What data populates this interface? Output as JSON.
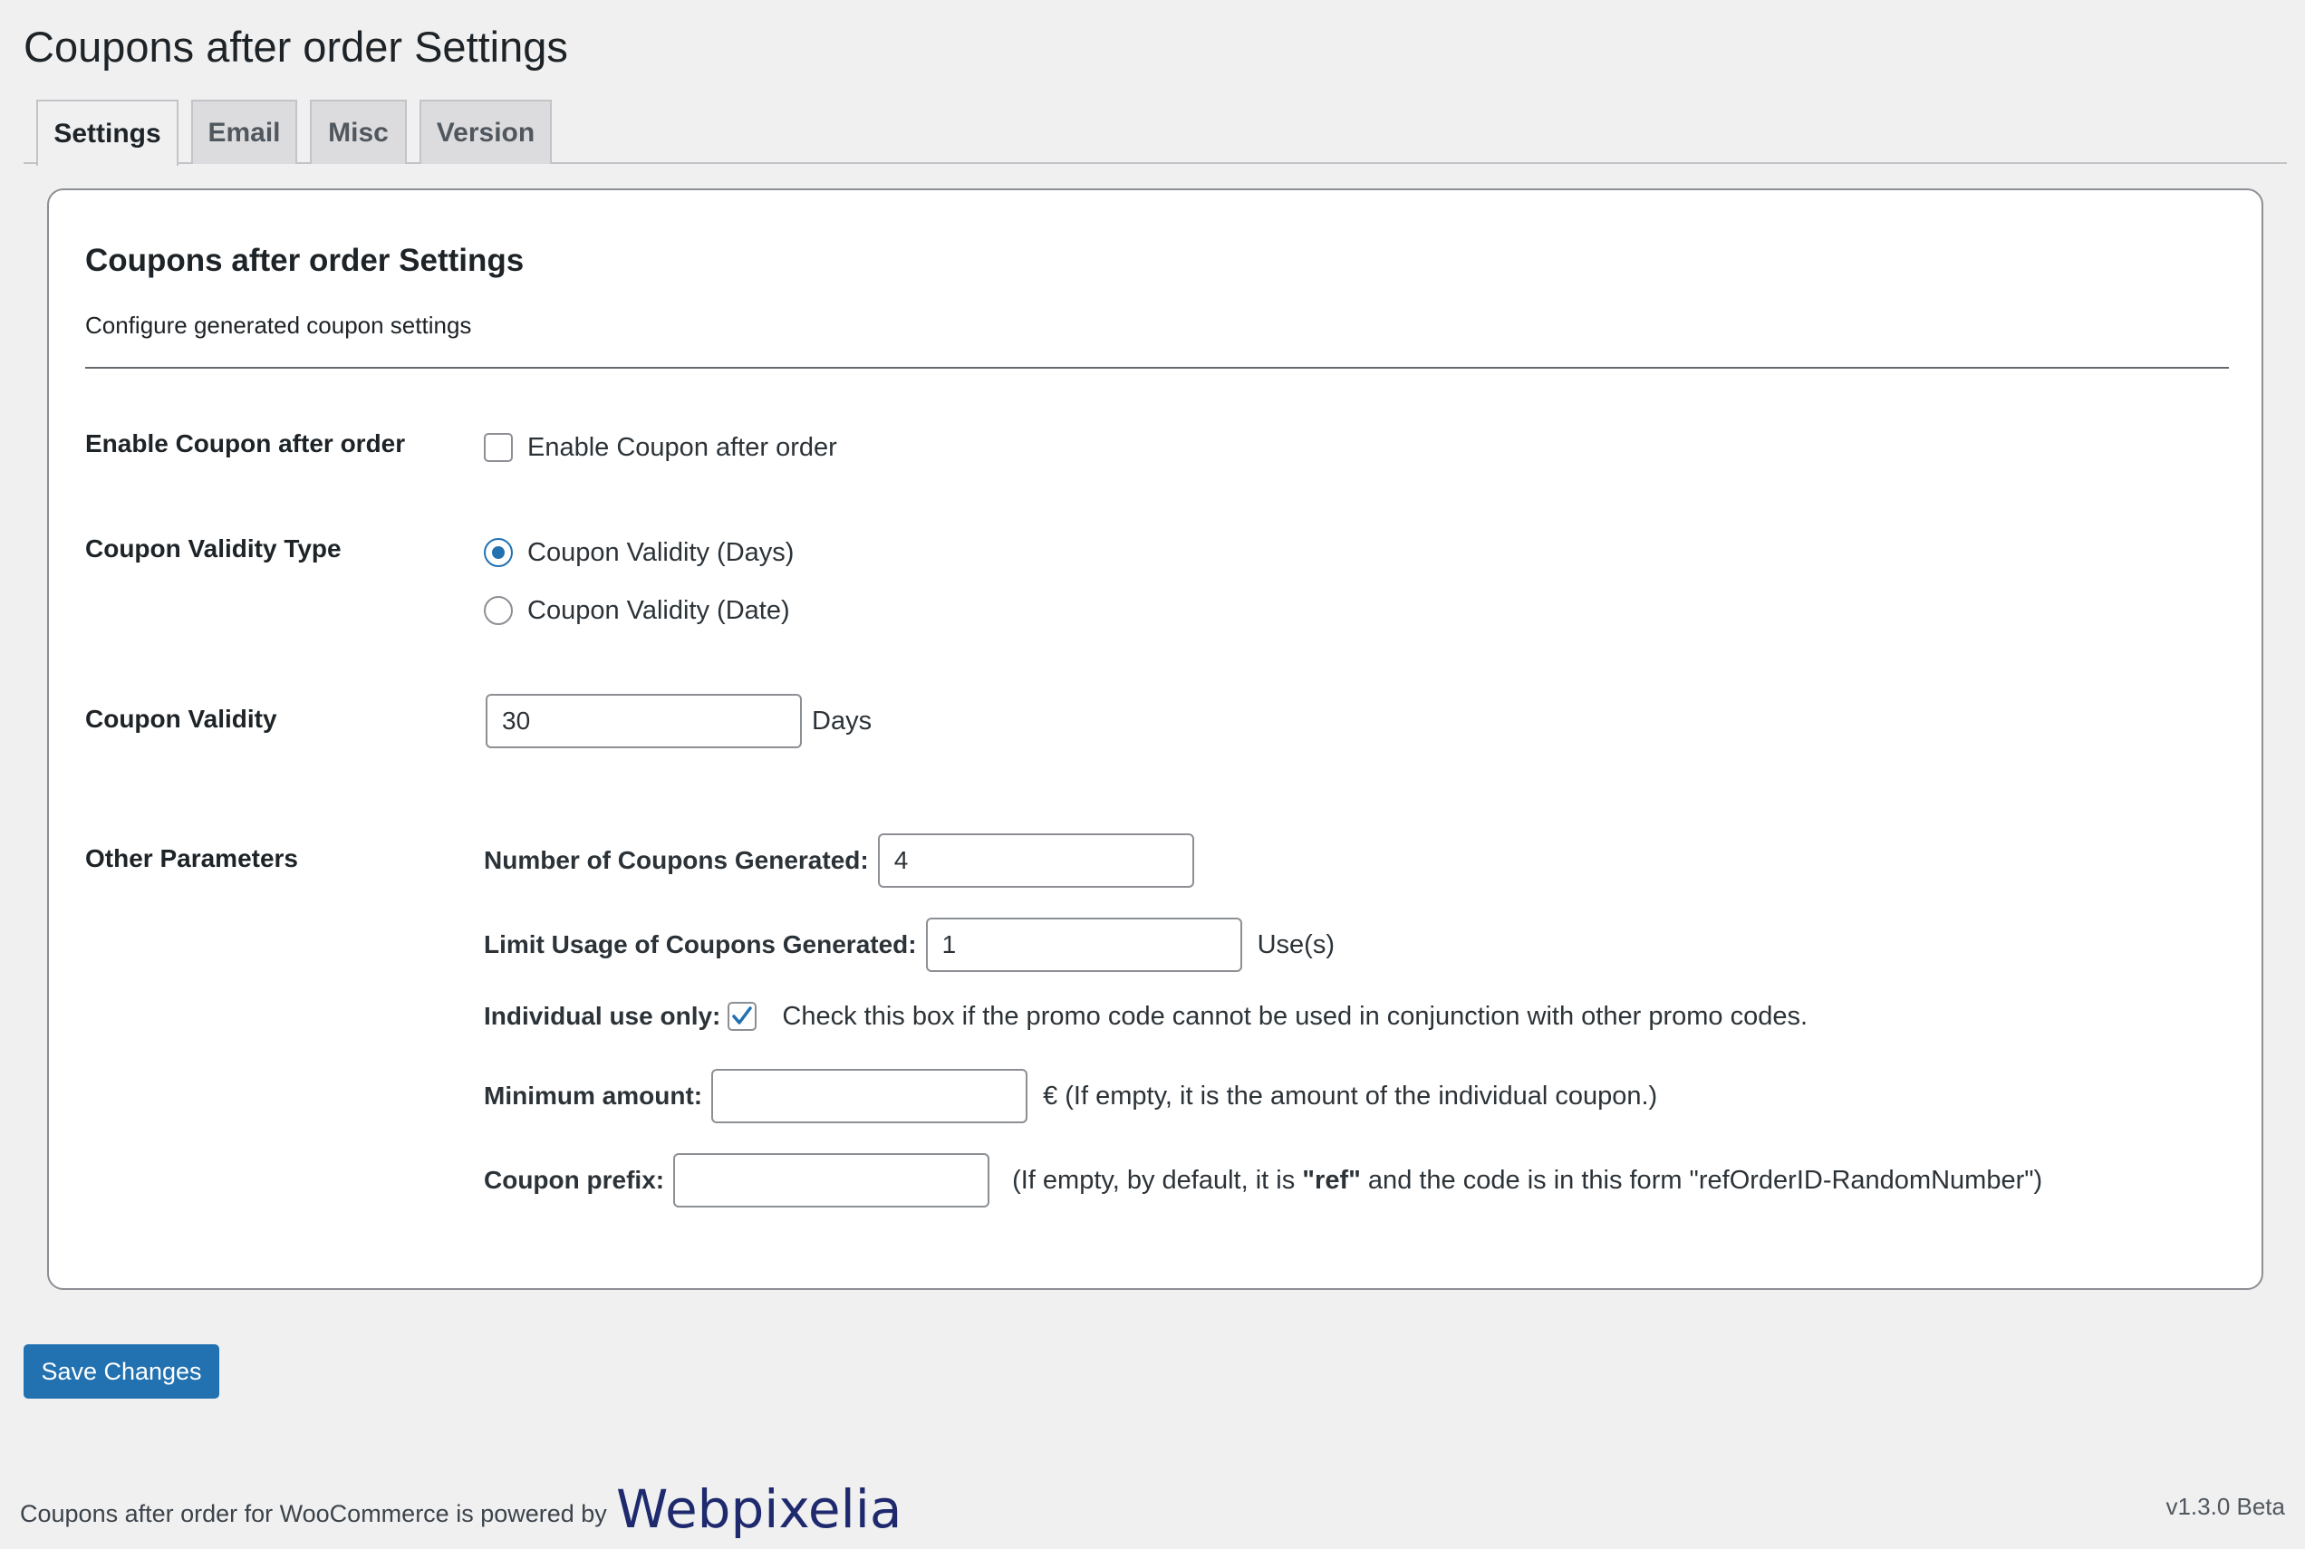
{
  "page": {
    "title": "Coupons after order Settings"
  },
  "tabs": [
    {
      "label": "Settings",
      "active": true
    },
    {
      "label": "Email",
      "active": false
    },
    {
      "label": "Misc",
      "active": false
    },
    {
      "label": "Version",
      "active": false
    }
  ],
  "card": {
    "title": "Coupons after order Settings",
    "description": "Configure generated coupon settings"
  },
  "enable": {
    "label": "Enable Coupon after order",
    "checkbox_label": "Enable Coupon after order",
    "checked": false
  },
  "validity_type": {
    "label": "Coupon Validity Type",
    "options": [
      {
        "label": "Coupon Validity (Days)",
        "selected": true
      },
      {
        "label": "Coupon Validity (Date)",
        "selected": false
      }
    ]
  },
  "validity": {
    "label": "Coupon Validity",
    "value": "30",
    "unit": "Days"
  },
  "other": {
    "label": "Other Parameters",
    "num_coupons": {
      "label": "Number of Coupons Generated:",
      "value": "4"
    },
    "limit_usage": {
      "label": "Limit Usage of Coupons Generated:",
      "value": "1",
      "unit": "Use(s)"
    },
    "individual_use": {
      "label": "Individual use only:",
      "checked": true,
      "description": "Check this box if the promo code cannot be used in conjunction with other promo codes."
    },
    "minimum_amount": {
      "label": "Minimum amount:",
      "value": "",
      "hint": "€ (If empty, it is the amount of the individual coupon.)"
    },
    "coupon_prefix": {
      "label": "Coupon prefix:",
      "value": "",
      "hint_before": "(If empty, by default, it is ",
      "hint_bold": "\"ref\"",
      "hint_after": " and the code is in this form \"refOrderID-RandomNumber\")"
    }
  },
  "save_label": "Save Changes",
  "footer": {
    "text": "Coupons after order for WooCommerce is powered by",
    "logo": "Webpixelia",
    "version": "v1.3.0 Beta"
  },
  "colors": {
    "accent": "#2271b1",
    "background": "#f0f0f1",
    "logo": "#1f2a6e"
  }
}
